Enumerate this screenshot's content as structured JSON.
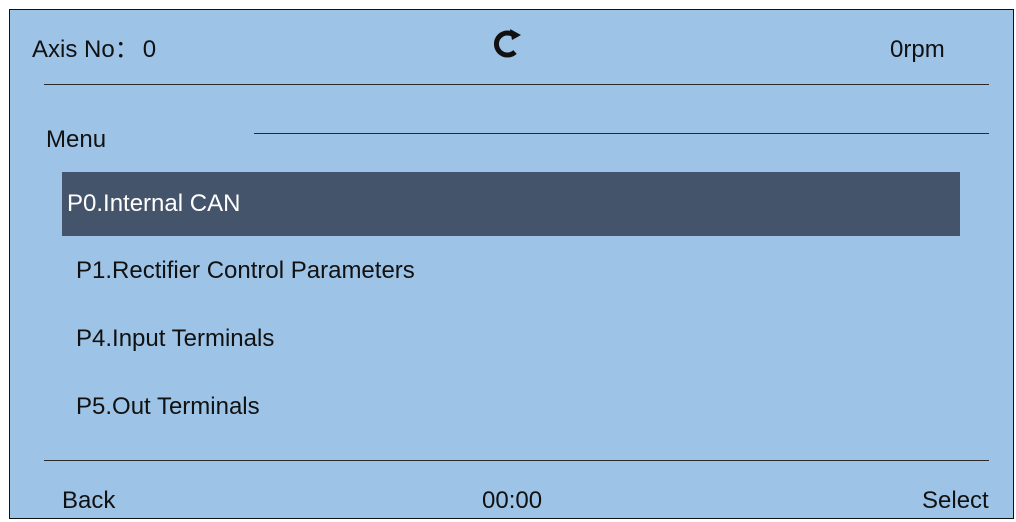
{
  "header": {
    "axis_label": "Axis No：",
    "axis_value": "0",
    "speed": "0rpm",
    "refresh_icon": "refresh-icon"
  },
  "menu": {
    "title": "Menu",
    "items": [
      {
        "label": "P0.Internal CAN",
        "selected": true
      },
      {
        "label": "P1.Rectifier Control Parameters",
        "selected": false
      },
      {
        "label": "P4.Input Terminals",
        "selected": false
      },
      {
        "label": "P5.Out Terminals",
        "selected": false
      }
    ]
  },
  "footer": {
    "back_label": "Back",
    "time": "00:00",
    "select_label": "Select"
  },
  "colors": {
    "background": "#9dc3e6",
    "selected_row": "#44546a",
    "selected_text": "#ffffff"
  }
}
